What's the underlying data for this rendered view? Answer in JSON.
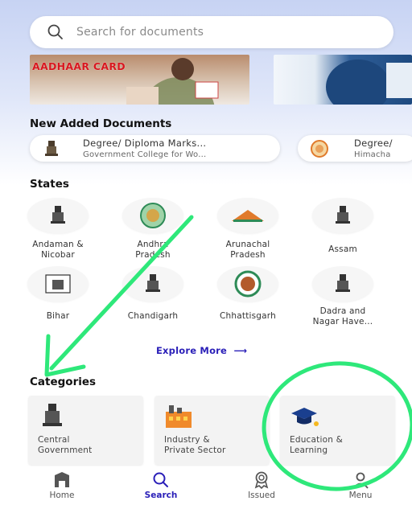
{
  "search": {
    "placeholder": "Search for documents",
    "icon": "search-icon"
  },
  "banners": [
    {
      "title": "AADHAAR CARD"
    },
    {
      "title": ""
    }
  ],
  "new_added": {
    "title": "New Added Documents",
    "items": [
      {
        "title": "Degree/ Diploma Marks...",
        "subtitle": "Government College for Wo..."
      },
      {
        "title": "Degree/",
        "subtitle": "Himacha"
      }
    ]
  },
  "states": {
    "title": "States",
    "items": [
      {
        "label": "Andaman &\nNicobar"
      },
      {
        "label": "Andhra\nPradesh"
      },
      {
        "label": "Arunachal\nPradesh"
      },
      {
        "label": "Assam"
      },
      {
        "label": "Bihar"
      },
      {
        "label": "Chandigarh"
      },
      {
        "label": "Chhattisgarh"
      },
      {
        "label": "Dadra and\nNagar Have..."
      }
    ],
    "explore_label": "Explore More"
  },
  "categories": {
    "title": "Categories",
    "items": [
      {
        "label": "Central\nGovernment"
      },
      {
        "label": "Industry &\nPrivate Sector"
      },
      {
        "label": "Education &\nLearning"
      }
    ]
  },
  "bottom_nav": {
    "items": [
      {
        "label": "Home"
      },
      {
        "label": "Search"
      },
      {
        "label": "Issued"
      },
      {
        "label": "Menu"
      }
    ],
    "active": "Search"
  },
  "colors": {
    "accent": "#2a1fb8",
    "annotation_green": "#2ee87a",
    "banner_red": "#d8171f"
  }
}
